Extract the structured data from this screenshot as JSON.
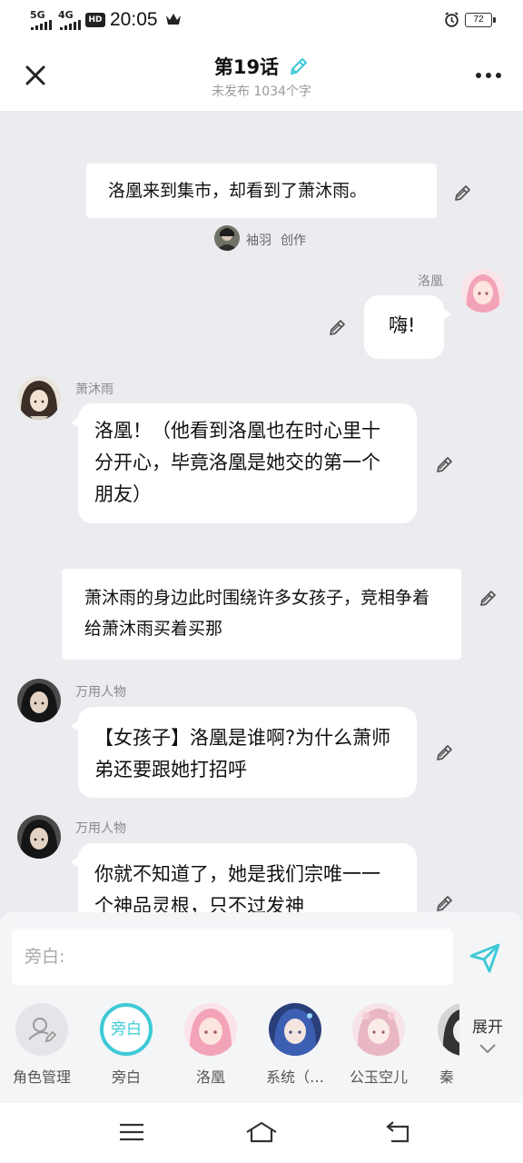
{
  "status": {
    "net1": "5G",
    "net2": "4G",
    "hd": "HD",
    "time": "20:05",
    "battery": "72"
  },
  "header": {
    "title": "第19话",
    "subtitle": "未发布 1034个字"
  },
  "messages": {
    "narr1": "洛凰来到集市，却看到了萧沐雨。",
    "creator_name": "袖羽",
    "creator_suffix": "创作",
    "m1_name": "洛凰",
    "m1_text": "嗨!",
    "m2_name": "萧沐雨",
    "m2_text": "洛凰！（他看到洛凰也在时心里十分开心，毕竟洛凰是她交的第一个朋友）",
    "narr2": "萧沐雨的身边此时围绕许多女孩子，竞相争着给萧沐雨买着买那",
    "m3_name": "万用人物",
    "m3_text": "【女孩子】洛凰是谁啊?为什么萧师弟还要跟她打招呼",
    "m4_name": "万用人物",
    "m4_text": "你就不知道了，她是我们宗唯一一个神品灵根，只不过发神"
  },
  "input": {
    "placeholder": "旁白:"
  },
  "roles": {
    "manage": "角色管理",
    "narration": "旁白",
    "narration_circle": "旁白",
    "luohuang": "洛凰",
    "system": "系统（…",
    "gongyu": "公玉空儿",
    "partial": "秦",
    "expand": "展开"
  },
  "colors": {
    "accent": "#3dc9d6",
    "background": "#ebecf0"
  }
}
